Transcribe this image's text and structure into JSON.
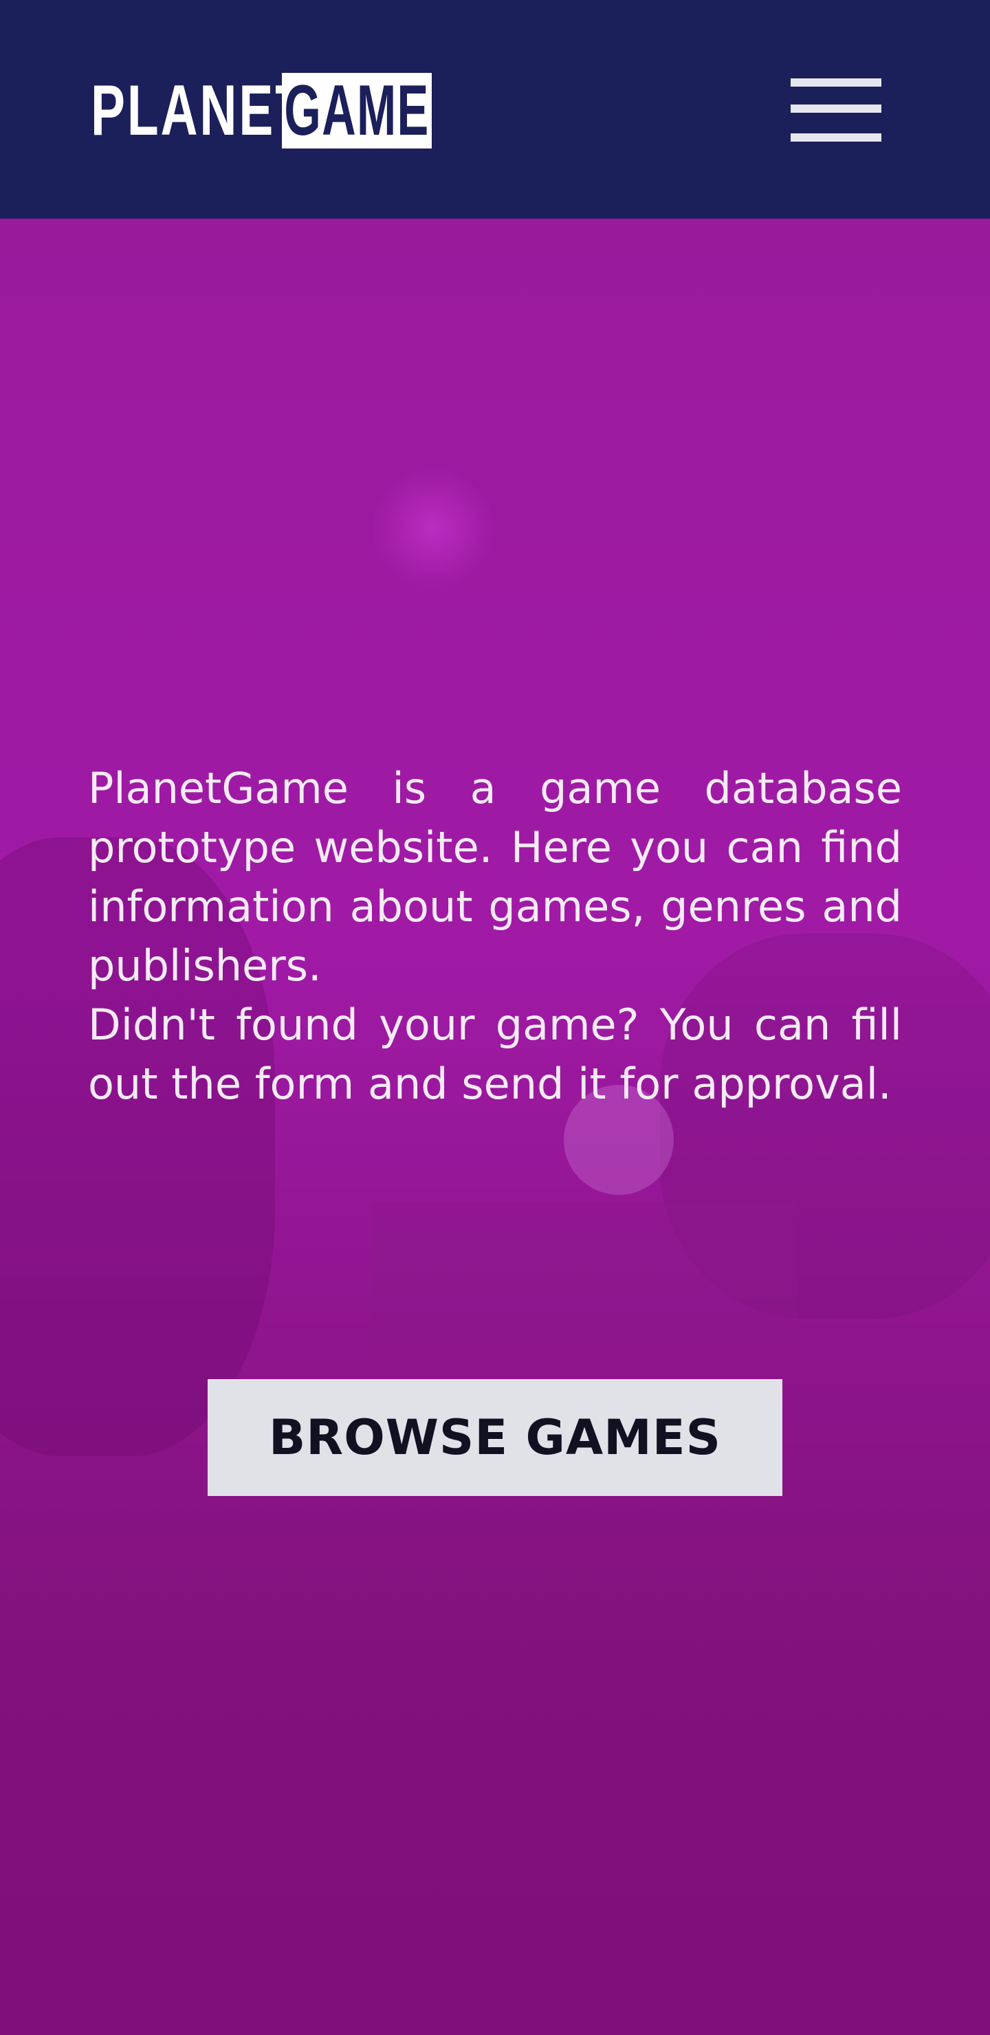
{
  "header": {
    "logo_planet": "PLANET",
    "logo_game": "GAME",
    "menu_icon": "hamburger-menu-icon"
  },
  "hero": {
    "paragraph_1": "PlanetGame is a game database prototype website. Here you can find information about games, genres and publishers.",
    "paragraph_2": "Didn't found your game? You can fill out the form and send it for approval.",
    "browse_button_label": "BROWSE GAMES"
  },
  "colors": {
    "header_background": "#1b1f5a",
    "hero_overlay": "#9a1a9c",
    "button_background": "#e1e1e8",
    "text_light": "#f4ebf5"
  }
}
